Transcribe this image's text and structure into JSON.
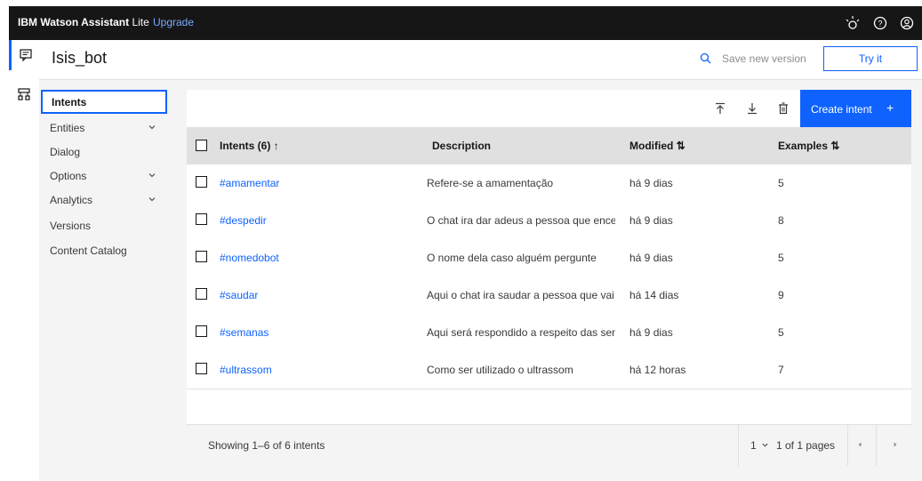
{
  "topbar": {
    "brand_strong": "IBM Watson Assistant",
    "brand_light": " Lite",
    "upgrade": "Upgrade"
  },
  "header": {
    "bot_name": "Isis_bot",
    "save_version": "Save new version",
    "try_it": "Try it"
  },
  "nav": {
    "items": [
      {
        "label": "Intents"
      },
      {
        "label": "Entities"
      },
      {
        "label": "Dialog"
      },
      {
        "label": "Options"
      },
      {
        "label": "Analytics"
      },
      {
        "label": "Versions"
      },
      {
        "label": "Content Catalog"
      }
    ]
  },
  "toolbar": {
    "create": "Create intent",
    "plus": "+"
  },
  "table": {
    "headers": {
      "intents": "Intents (6) ↑",
      "description": "Description",
      "modified": "Modified ⇅",
      "examples": "Examples ⇅"
    },
    "rows": [
      {
        "name": "#amamentar",
        "description": "Refere-se a amamentação",
        "modified": "há 9 dias",
        "examples": "5"
      },
      {
        "name": "#despedir",
        "description": "O chat ira dar adeus a pessoa que encer...",
        "modified": "há 9 dias",
        "examples": "8"
      },
      {
        "name": "#nomedobot",
        "description": "O nome dela caso alguém pergunte",
        "modified": "há 9 dias",
        "examples": "5"
      },
      {
        "name": "#saudar",
        "description": "Aqui o chat ira saudar a pessoa que vai f...",
        "modified": "há 14 dias",
        "examples": "9"
      },
      {
        "name": "#semanas",
        "description": "Aqui será respondido a respeito das sem...",
        "modified": "há 9 dias",
        "examples": "5"
      },
      {
        "name": "#ultrassom",
        "description": "Como ser utilizado o ultrassom",
        "modified": "há 12 horas",
        "examples": "7"
      }
    ]
  },
  "pagination": {
    "showing": "Showing 1–6 of 6 intents",
    "page": "1",
    "of_pages": "1 of 1 pages"
  },
  "colors": {
    "accent": "#0f62fe",
    "topbar": "#161616"
  }
}
